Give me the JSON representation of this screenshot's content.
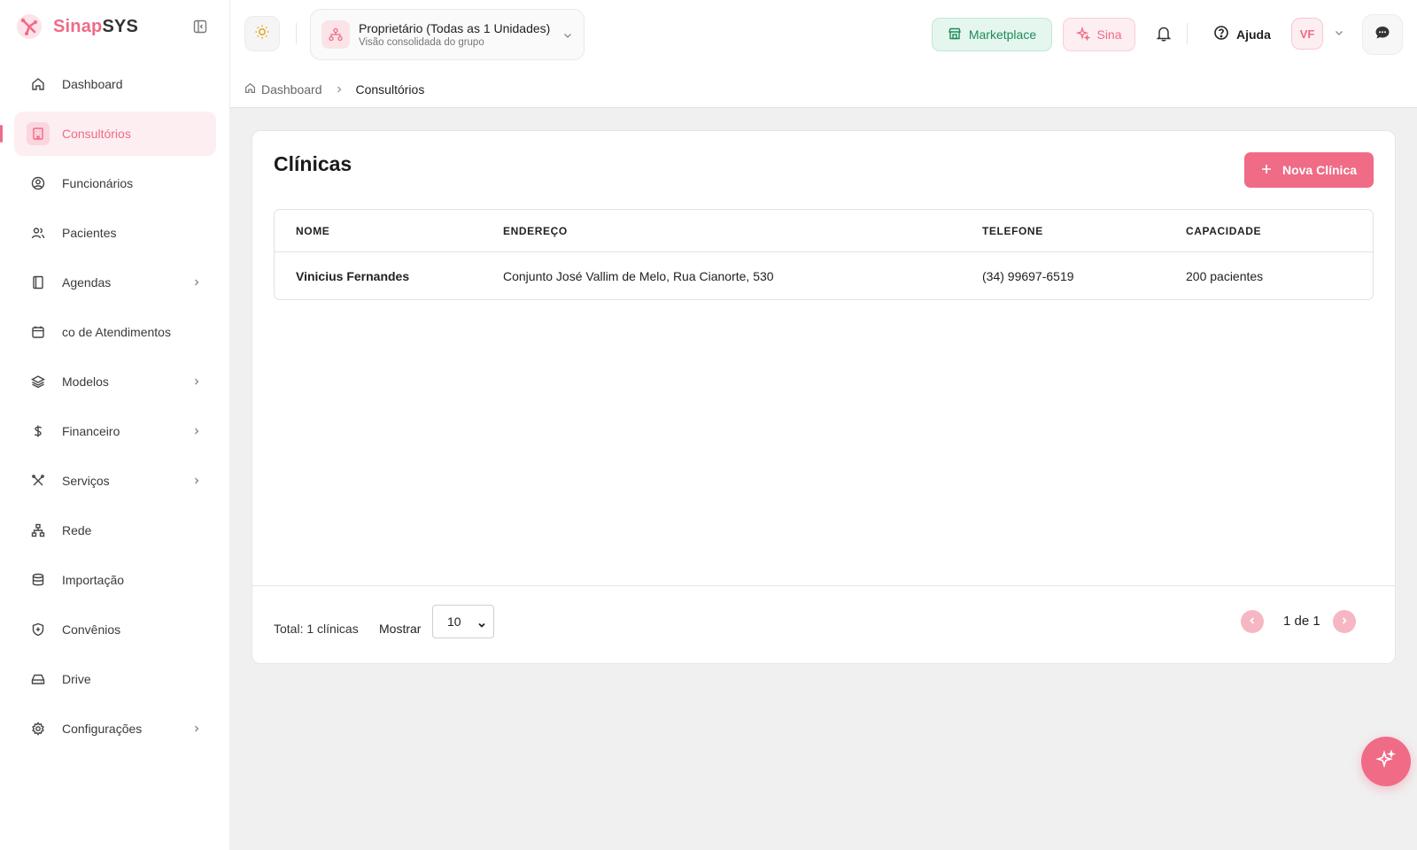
{
  "brand": {
    "name_a": "Sinap",
    "name_b": "SYS"
  },
  "sidebar": {
    "items": [
      {
        "label": "Dashboard",
        "icon": "home-icon"
      },
      {
        "label": "Consultórios",
        "icon": "building-icon",
        "active": true
      },
      {
        "label": "Funcionários",
        "icon": "user-circle-icon"
      },
      {
        "label": "Pacientes",
        "icon": "users-icon"
      },
      {
        "label": "Agendas",
        "icon": "book-icon",
        "has_submenu": true
      },
      {
        "label": "co de Atendimentos",
        "icon": "calendar-icon"
      },
      {
        "label": "Modelos",
        "icon": "layers-icon",
        "has_submenu": true
      },
      {
        "label": "Financeiro",
        "icon": "dollar-icon",
        "has_submenu": true
      },
      {
        "label": "Serviços",
        "icon": "tools-icon",
        "has_submenu": true
      },
      {
        "label": "Rede",
        "icon": "network-icon"
      },
      {
        "label": "Importação",
        "icon": "database-icon"
      },
      {
        "label": "Convênios",
        "icon": "shield-icon"
      },
      {
        "label": "Drive",
        "icon": "drive-icon"
      },
      {
        "label": "Configurações",
        "icon": "gear-icon",
        "has_submenu": true
      }
    ]
  },
  "topbar": {
    "unit_title": "Proprietário (Todas as 1 Unidades)",
    "unit_subtitle": "Visão consolidada do grupo",
    "marketplace_label": "Marketplace",
    "sina_label": "Sina",
    "help_label": "Ajuda",
    "avatar_initials": "VF"
  },
  "breadcrumb": {
    "home": "Dashboard",
    "current": "Consultórios"
  },
  "main": {
    "title": "Clínicas",
    "new_button_label": "Nova Clínica",
    "table": {
      "headers": [
        "NOME",
        "ENDEREÇO",
        "TELEFONE",
        "CAPACIDADE"
      ],
      "rows": [
        [
          "Vinicius Fernandes",
          "Conjunto José Vallim de Melo, Rua Cianorte, 530",
          "(34) 99697-6519",
          "200 pacientes"
        ]
      ]
    },
    "footer": {
      "total_label": "Total: 1 clínicas",
      "show_label": "Mostrar",
      "per_page": "10",
      "pagination": "1 de 1"
    }
  },
  "colors": {
    "accent": "#ef6b86",
    "accent_light": "#fdeef1",
    "marketplace": "#1f8a5b"
  }
}
